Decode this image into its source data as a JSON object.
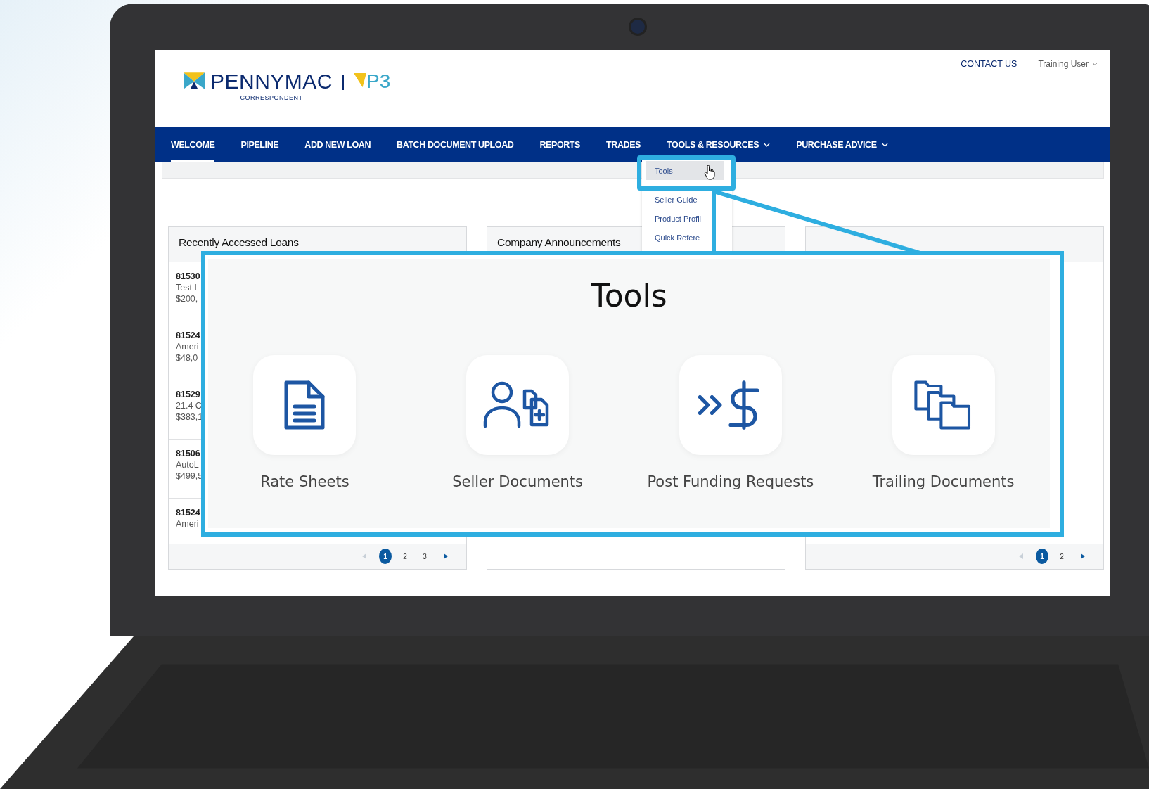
{
  "header": {
    "logo": {
      "brand": "PENNYMAC",
      "product": "P3",
      "subtitle": "CORRESPONDENT"
    },
    "links": [
      {
        "label": "CONTACT US",
        "dropdown": false
      },
      {
        "label": "Training User",
        "dropdown": true
      }
    ]
  },
  "nav": [
    {
      "label": "WELCOME",
      "selected": true,
      "dropdown": false
    },
    {
      "label": "PIPELINE",
      "selected": false,
      "dropdown": false
    },
    {
      "label": "ADD NEW LOAN",
      "selected": false,
      "dropdown": false
    },
    {
      "label": "BATCH DOCUMENT UPLOAD",
      "selected": false,
      "dropdown": false
    },
    {
      "label": "REPORTS",
      "selected": false,
      "dropdown": false
    },
    {
      "label": "TRADES",
      "selected": false,
      "dropdown": false
    },
    {
      "label": "TOOLS & RESOURCES",
      "selected": false,
      "dropdown": true
    },
    {
      "label": "PURCHASE ADVICE",
      "selected": false,
      "dropdown": true
    }
  ],
  "dropdown_menu": [
    {
      "label": "Tools",
      "selected": true
    },
    {
      "label": "Seller Guide",
      "selected": false
    },
    {
      "label": "Product Profil",
      "selected": false
    },
    {
      "label": "Quick Refere",
      "selected": false
    }
  ],
  "panels": [
    {
      "title": "Recently Accessed Loans",
      "rows": [
        {
          "id": "81530",
          "line_2": "Test L",
          "line_3": "$200,"
        },
        {
          "id": "81524",
          "line_2": "Ameri",
          "line_3": "$48,0"
        },
        {
          "id": "81529",
          "line_2": "21.4 C",
          "line_3": "$383,1"
        },
        {
          "id": "81506",
          "line_2": "AutoL",
          "line_3": "$499,5"
        },
        {
          "id": "81524",
          "line_2": "Ameri"
        }
      ],
      "pages": [
        {
          "label": "1",
          "selected": true
        },
        {
          "label": "2",
          "selected": false
        },
        {
          "label": "3",
          "selected": false
        }
      ]
    },
    {
      "title": "Company Announcements"
    },
    {
      "pages": [
        {
          "label": "1",
          "selected": true
        },
        {
          "label": "2",
          "selected": false
        }
      ]
    }
  ],
  "callout": {
    "title": "Tools",
    "tools": [
      {
        "label": "Rate Sheets",
        "kind": "document"
      },
      {
        "label": "Seller Documents",
        "kind": "person-files"
      },
      {
        "label": "Post Funding Requests",
        "kind": "funding"
      },
      {
        "label": "Trailing Documents",
        "kind": "folders"
      }
    ]
  }
}
